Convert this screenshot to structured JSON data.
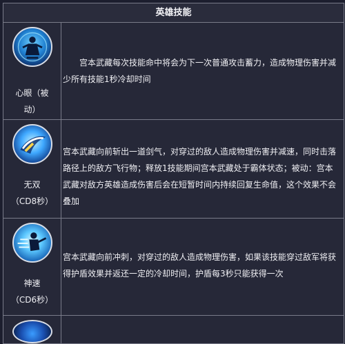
{
  "header": {
    "title": "英雄技能"
  },
  "skills": [
    {
      "icon": "hero-meditate-icon",
      "name_line1": "心眼（被",
      "name_line2": "动）",
      "description": "宫本武藏每次技能命中将会为下一次普通攻击蓄力，造成物理伤害并减少所有技能1秒冷却时间"
    },
    {
      "icon": "sword-wave-icon",
      "name_line1": "无双",
      "name_line2": "（CD8秒）",
      "description": "宫本武藏向前斩出一道剑气，对穿过的敌人造成物理伤害并减速，同时击落路径上的敌方飞行物；释放1技能期间宫本武藏处于霸体状态；被动：宫本武藏对敌方英雄造成伤害后会在短暂时间内持续回复生命值，这个效果不会叠加"
    },
    {
      "icon": "dash-strike-icon",
      "name_line1": "神速",
      "name_line2": "（CD6秒）",
      "description": "宫本武藏向前冲刺，对穿过的敌人造成物理伤害，如果该技能穿过敌军将获得护盾效果并返还一定的冷却时间，护盾每3秒只能获得一次"
    },
    {
      "icon": "ultimate-skill-icon",
      "name_line1": "",
      "name_line2": "",
      "description": ""
    }
  ]
}
